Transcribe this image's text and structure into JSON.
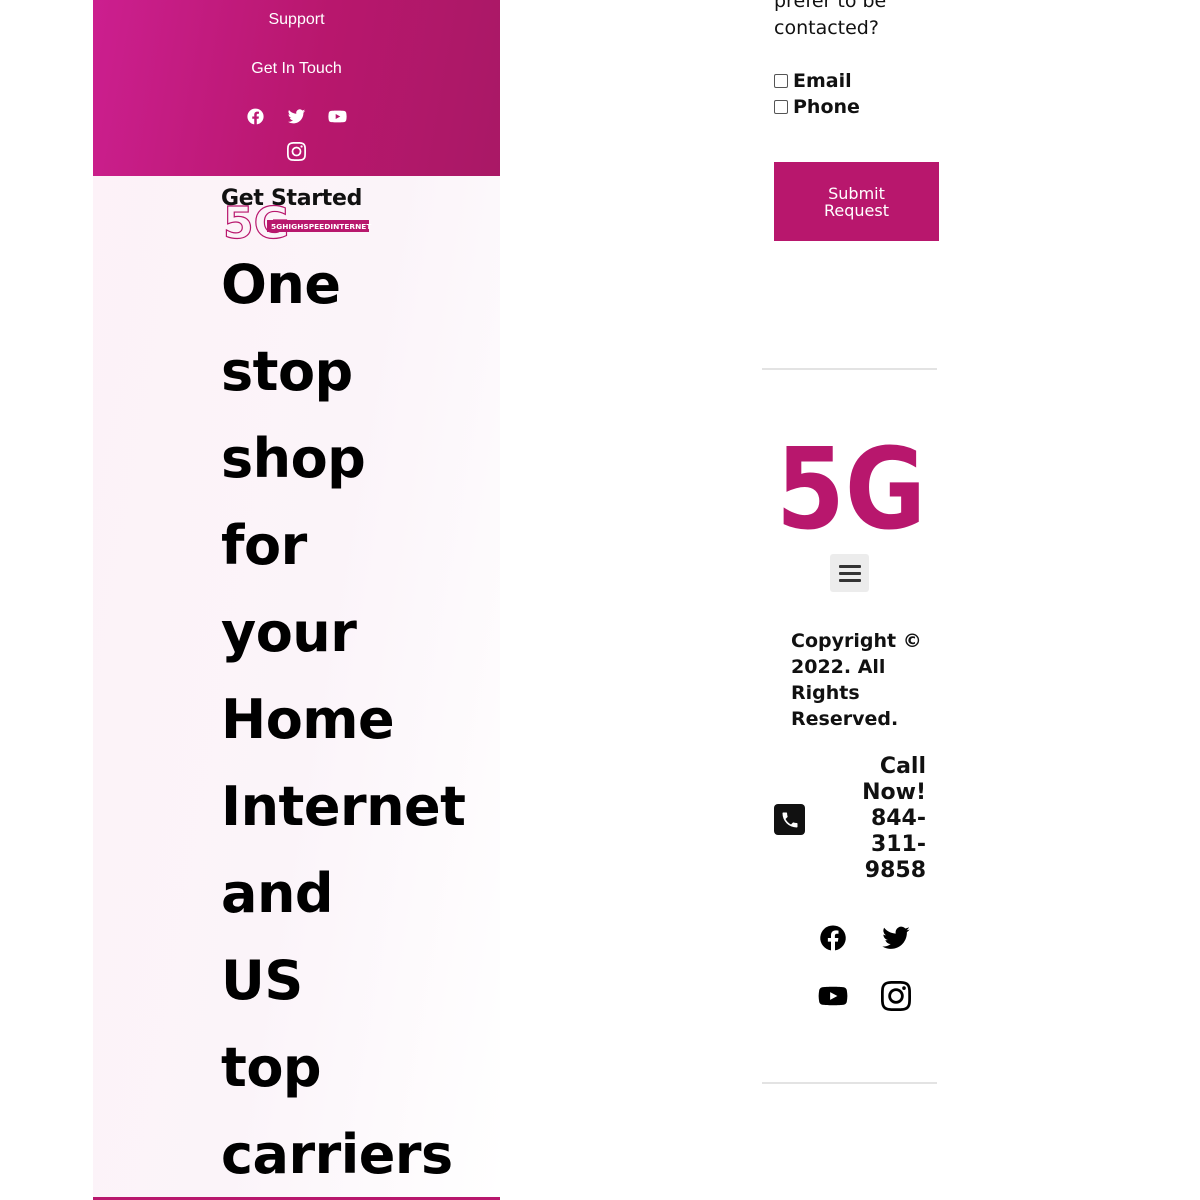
{
  "nav": {
    "support": "Support",
    "get_in_touch": "Get In Touch",
    "social_icons": [
      "facebook-icon",
      "twitter-icon",
      "youtube-icon",
      "instagram-icon"
    ]
  },
  "hero": {
    "get_started": "Get Started",
    "logo": {
      "main": "5G",
      "tag": "5GHIGHSPEEDINTERNET"
    },
    "headline_words": [
      "One",
      "stop",
      "shop",
      "for",
      "your",
      "Home",
      "Internet",
      "and",
      "US",
      "top",
      "carriers"
    ]
  },
  "form": {
    "contact_question": "prefer to be contacted?",
    "options": [
      "Email",
      "Phone"
    ],
    "submit_label": "Submit Request"
  },
  "footer": {
    "logo_text": "5G",
    "menu_icon": "hamburger-menu-icon",
    "copyright": "Copyright © 2022. All Rights Reserved.",
    "call_label": "Call Now! 844-311-9858",
    "social_icons": [
      "facebook-icon",
      "twitter-icon",
      "youtube-icon",
      "instagram-icon"
    ]
  },
  "colors": {
    "brand": "#b8176d",
    "brand_light": "#cc1f8f",
    "text": "#111111"
  }
}
